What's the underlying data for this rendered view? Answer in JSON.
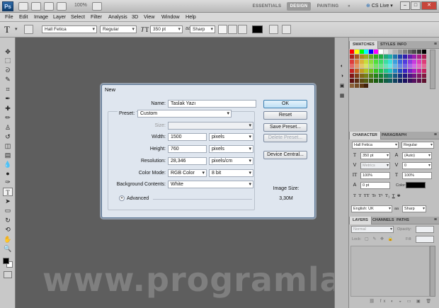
{
  "app": {
    "logo": "Ps",
    "zoom": "100%",
    "workspaces": [
      "ESSENTIALS",
      "DESIGN",
      "PAINTING"
    ],
    "cs_live": "CS Live",
    "window_controls": [
      "–",
      "□",
      "✕"
    ]
  },
  "menu": [
    "File",
    "Edit",
    "Image",
    "Layer",
    "Select",
    "Filter",
    "Analysis",
    "3D",
    "View",
    "Window",
    "Help"
  ],
  "options": {
    "font_family": "Hall Fetica",
    "font_style": "Regular",
    "font_size": "350 pt",
    "aa_label": "aa",
    "anti_alias": "Sharp",
    "text_color": "#000000"
  },
  "tools": [
    {
      "name": "move-tool",
      "glyph": "✥"
    },
    {
      "name": "marquee-tool",
      "glyph": "⬚"
    },
    {
      "name": "lasso-tool",
      "glyph": "ᘐ"
    },
    {
      "name": "quick-select-tool",
      "glyph": "✎"
    },
    {
      "name": "crop-tool",
      "glyph": "⌗"
    },
    {
      "name": "eyedropper-tool",
      "glyph": "✒"
    },
    {
      "name": "healing-brush-tool",
      "glyph": "✚"
    },
    {
      "name": "brush-tool",
      "glyph": "✏"
    },
    {
      "name": "clone-stamp-tool",
      "glyph": "♙"
    },
    {
      "name": "history-brush-tool",
      "glyph": "↺"
    },
    {
      "name": "eraser-tool",
      "glyph": "◫"
    },
    {
      "name": "gradient-tool",
      "glyph": "▤"
    },
    {
      "name": "blur-tool",
      "glyph": "💧"
    },
    {
      "name": "dodge-tool",
      "glyph": "●"
    },
    {
      "name": "pen-tool",
      "glyph": "✑"
    },
    {
      "name": "type-tool",
      "glyph": "T"
    },
    {
      "name": "path-select-tool",
      "glyph": "➤"
    },
    {
      "name": "shape-tool",
      "glyph": "▭"
    },
    {
      "name": "3d-rotate-tool",
      "glyph": "↻"
    },
    {
      "name": "3d-camera-tool",
      "glyph": "⟲"
    },
    {
      "name": "hand-tool",
      "glyph": "✋"
    },
    {
      "name": "zoom-tool",
      "glyph": "🔍"
    }
  ],
  "watermark": "www.programlar.com",
  "swatches": {
    "tabs": [
      "SWATCHES",
      "STYLES",
      "INFO"
    ]
  },
  "character": {
    "tabs": [
      "CHARACTER",
      "PARAGRAPH"
    ],
    "font_family": "Hall Fetica",
    "font_style": "Regular",
    "font_size": "350 pt",
    "leading": "(Auto)",
    "kerning": "Metrics",
    "tracking": "0",
    "vertical_scale": "100%",
    "horizontal_scale": "100%",
    "baseline_shift": "0 pt",
    "color_label": "Color:",
    "style_buttons": [
      "T",
      "T",
      "TT",
      "Tr",
      "T¹",
      "T₁",
      "T",
      "T"
    ],
    "language": "English: UK",
    "aa_label": "aa",
    "anti_alias": "Sharp"
  },
  "layers": {
    "tabs": [
      "LAYERS",
      "CHANNELS",
      "PATHS"
    ],
    "blend_mode": "Normal",
    "opacity_label": "Opacity:",
    "fill_label": "Fill:",
    "lock_label": "Lock:"
  },
  "dialog": {
    "title": "New",
    "name_label": "Name:",
    "name_value": "Taslak Yazı",
    "preset_label": "Preset:",
    "preset_value": "Custom",
    "size_label": "Size:",
    "width_label": "Width:",
    "width_value": "1500",
    "width_unit": "pixels",
    "height_label": "Height:",
    "height_value": "760",
    "height_unit": "pixels",
    "resolution_label": "Resolution:",
    "resolution_value": "28,346",
    "resolution_unit": "pixels/cm",
    "color_mode_label": "Color Mode:",
    "color_mode_value": "RGB Color",
    "bit_depth": "8 bit",
    "background_label": "Background Contents:",
    "background_value": "White",
    "advanced_label": "Advanced",
    "buttons": {
      "ok": "OK",
      "reset": "Reset",
      "save_preset": "Save Preset...",
      "delete_preset": "Delete Preset...",
      "device_central": "Device Central..."
    },
    "image_size_label": "Image Size:",
    "image_size_value": "3,30M"
  }
}
